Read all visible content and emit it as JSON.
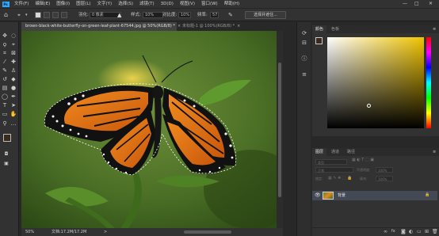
{
  "menu": {
    "items": [
      "文件(F)",
      "编辑(E)",
      "图像(I)",
      "图层(L)",
      "文字(Y)",
      "选择(S)",
      "滤镜(T)",
      "3D(D)",
      "视图(V)",
      "窗口(W)",
      "帮助(H)"
    ],
    "logo": "Ps",
    "window_controls": [
      "—",
      "□",
      "✕"
    ]
  },
  "options": {
    "feather_label": "羽化:",
    "feather_value": "0 像素",
    "style_label": "样式:",
    "style_value": "正常",
    "ratio_label": "对比度:",
    "ratio_value": "10%",
    "freq_label": "频率:",
    "freq_value": "57",
    "select_mask_button": "选择并遮住..."
  },
  "document": {
    "tab_active": "brown-black-white-butterfly-on-green-leaf-plant-67544.jpg @ 50%(RGB/8) *",
    "tab_inactive": "未标题-1 @ 100%(RGB/8) *",
    "zoom": "50%",
    "doc_size": "文档:17.2M/17.2M",
    "status_arrow": ">"
  },
  "panels": {
    "color_tabs": [
      "颜色",
      "色板"
    ],
    "layers_tabs": [
      "图层",
      "通道",
      "路径"
    ],
    "layer_kind": "类型",
    "blend_mode": "正常",
    "opacity_label": "不透明度:",
    "opacity_value": "100%",
    "lock_label": "锁定:",
    "fill_label": "填充:",
    "fill_value": "100%",
    "layer_name": "背景",
    "footer_icons": [
      "link-icon",
      "fx-icon",
      "mask-icon",
      "adjustment-icon",
      "group-icon",
      "new-layer-icon",
      "trash-icon"
    ]
  },
  "colors": {
    "foreground": "#3a2a1a",
    "background": "#c8401e",
    "app_bg": "#282828",
    "panel_bg": "#323232",
    "accent": "#31a8ff"
  }
}
